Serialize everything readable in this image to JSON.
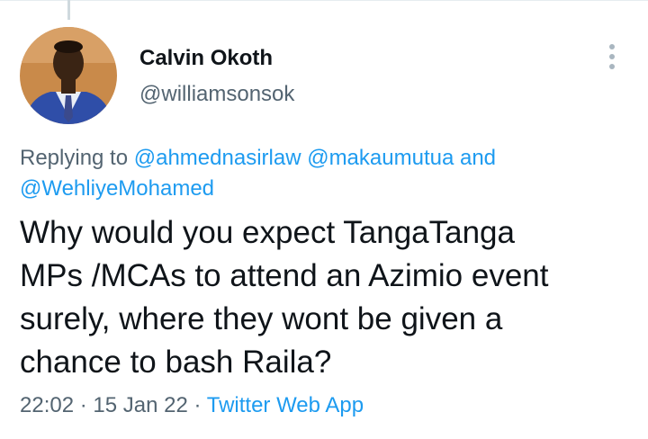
{
  "author": {
    "name": "Calvin Okoth",
    "handle": "@williamsonsok"
  },
  "reply": {
    "prefix": "Replying to",
    "mention1": "@ahmednasirlaw",
    "mention2": "@makaumutua",
    "conjunction": "and",
    "mention3": "@WehliyeMohamed"
  },
  "tweet": {
    "line1": "Why would you expect TangaTanga",
    "line2": "MPs /MCAs to attend an Azimio event",
    "line3": "surely, where they wont be given a",
    "line4": "chance to bash Raila?"
  },
  "meta": {
    "time": "22:02",
    "sep1": "·",
    "date": "15 Jan 22",
    "sep2": "·",
    "source": "Twitter Web App"
  },
  "icons": {
    "more": "more-vertical-icon"
  },
  "colors": {
    "link": "#1d9bf0",
    "secondary_text": "#536471",
    "primary_text": "#0f1419"
  }
}
